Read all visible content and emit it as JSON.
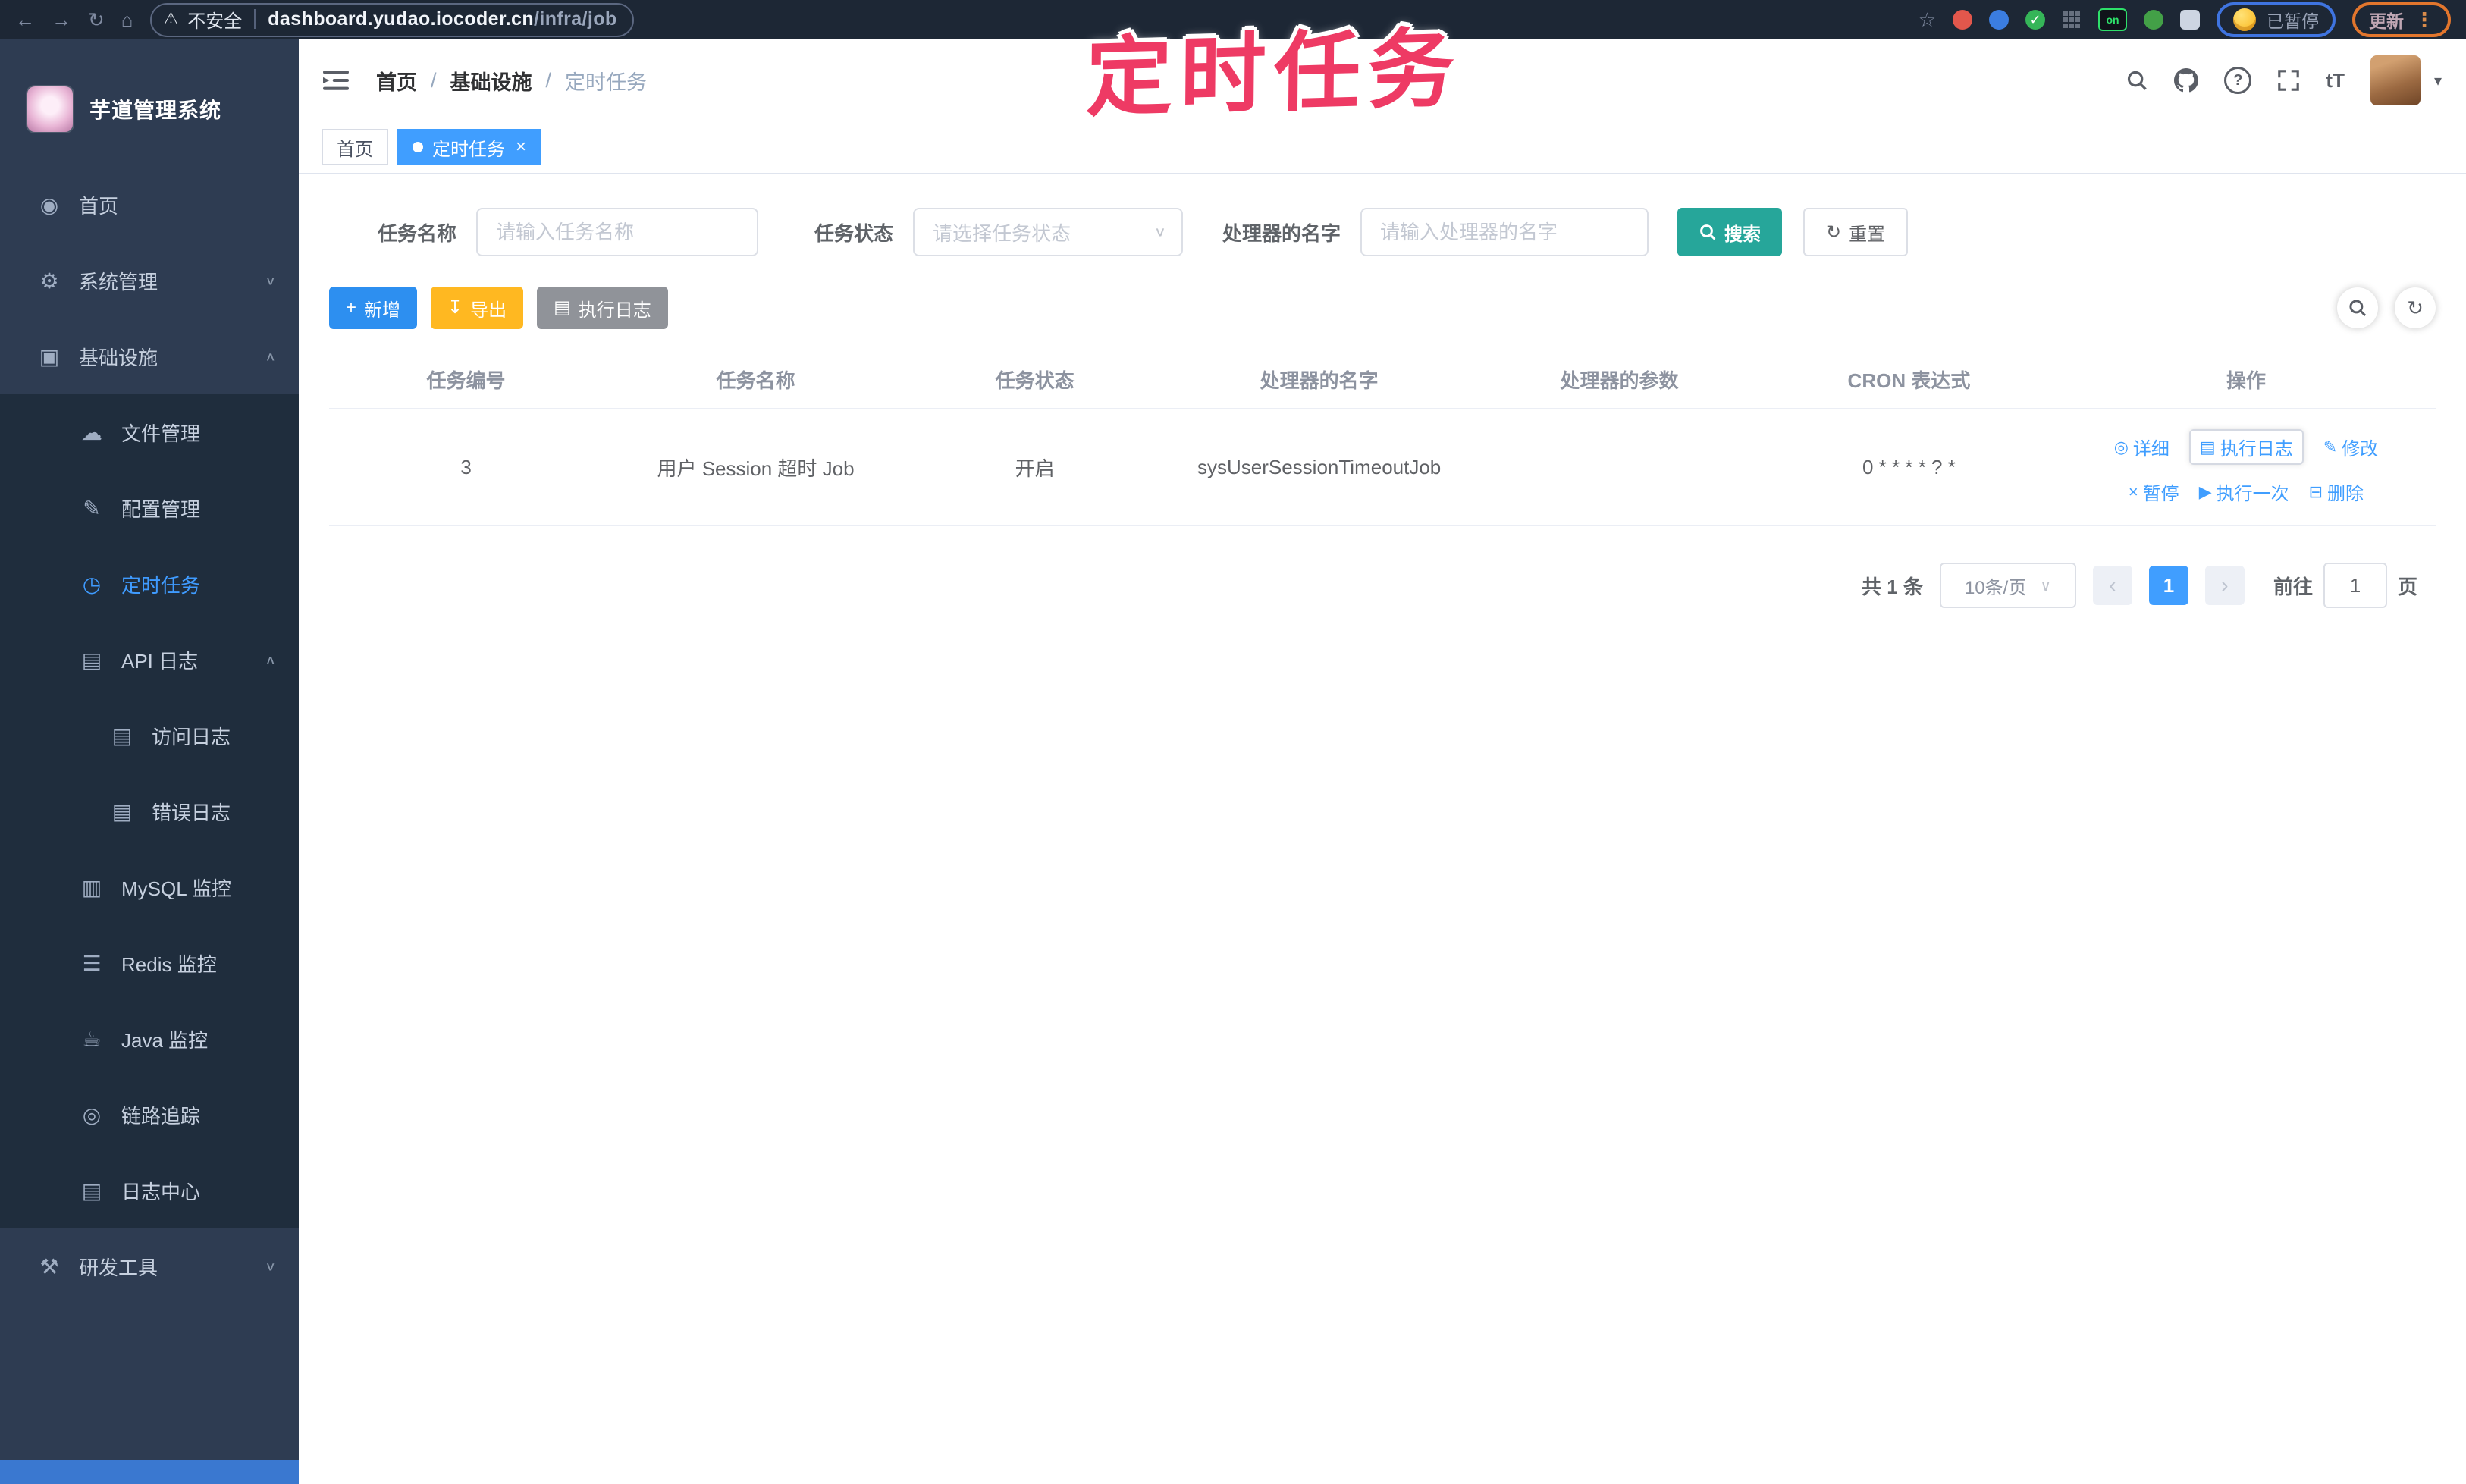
{
  "browser": {
    "security_warning": "不安全",
    "url_domain": "dashboard.yudao.iocoder.cn",
    "url_path": "/infra/job",
    "ext_on_badge": "on",
    "paused_badge": "已暂停",
    "update_button": "更新"
  },
  "overlay_annotation": "定时任务",
  "sidebar": {
    "logo_title": "芋道管理系统",
    "items": [
      {
        "label": "首页"
      },
      {
        "label": "系统管理"
      },
      {
        "label": "基础设施"
      },
      {
        "label": "文件管理"
      },
      {
        "label": "配置管理"
      },
      {
        "label": "定时任务"
      },
      {
        "label": "API 日志"
      },
      {
        "label": "访问日志"
      },
      {
        "label": "错误日志"
      },
      {
        "label": "MySQL 监控"
      },
      {
        "label": "Redis 监控"
      },
      {
        "label": "Java 监控"
      },
      {
        "label": "链路追踪"
      },
      {
        "label": "日志中心"
      },
      {
        "label": "研发工具"
      }
    ]
  },
  "breadcrumb": {
    "items": [
      "首页",
      "基础设施",
      "定时任务"
    ],
    "separator": "/"
  },
  "tags": {
    "home": "首页",
    "active": "定时任务"
  },
  "filters": {
    "name_label": "任务名称",
    "name_placeholder": "请输入任务名称",
    "status_label": "任务状态",
    "status_placeholder": "请选择任务状态",
    "handler_label": "处理器的名字",
    "handler_placeholder": "请输入处理器的名字",
    "search_label": "搜索",
    "reset_label": "重置"
  },
  "toolbar": {
    "add_label": "新增",
    "export_label": "导出",
    "exec_log_label": "执行日志"
  },
  "table": {
    "columns": [
      "任务编号",
      "任务名称",
      "任务状态",
      "处理器的名字",
      "处理器的参数",
      "CRON 表达式",
      "操作"
    ],
    "row": {
      "id": "3",
      "name": "用户 Session 超时 Job",
      "status": "开启",
      "handler": "sysUserSessionTimeoutJob",
      "params": "",
      "cron": "0 * * * * ? *"
    },
    "actions": {
      "detail": "详细",
      "log": "执行日志",
      "edit": "修改",
      "pause": "暂停",
      "run_once": "执行一次",
      "delete": "删除"
    }
  },
  "pagination": {
    "total": "共 1 条",
    "page_size": "10条/页",
    "page": "1",
    "goto_label": "前往",
    "goto_value": "1",
    "unit_label": "页"
  },
  "icons": {
    "back": "←",
    "forward": "→",
    "reload": "↻",
    "home": "⌂",
    "warning": "⚠",
    "star": "☆",
    "kebab": "⋮",
    "check": "✓",
    "caret_down": "▾",
    "close": "×",
    "chevron_down": "∨",
    "chevron_up": "∧",
    "question": "?",
    "font_size": "tT",
    "menu_dashboard": "◉",
    "menu_system": "⚙",
    "menu_infra": "▣",
    "menu_file": "☁",
    "menu_config": "✎",
    "menu_job": "◷",
    "menu_api_log": "▤",
    "menu_access_log": "▤",
    "menu_error_log": "▤",
    "menu_mysql": "▥",
    "menu_redis": "☰",
    "menu_java": "☕",
    "menu_trace": "◎",
    "menu_log_center": "▤",
    "menu_devtools": "⚒",
    "plus": "+",
    "download": "↧",
    "doc": "▤",
    "refresh": "↻",
    "op_detail": "◎",
    "op_log": "▤",
    "op_edit": "✎",
    "op_pause": "×",
    "op_run": "▶",
    "op_delete": "⊟",
    "select_caret": "∨",
    "prev": "‹",
    "next": "›"
  },
  "colors": {
    "accent_blue": "#409eff",
    "button_blue": "#2d8ff0",
    "search_teal": "#26a69a",
    "export_yellow": "#ffb821",
    "log_gray": "#909399",
    "annotation_red": "#ee3a64",
    "sidebar_bg": "#2e3c52",
    "submenu_bg": "#1f2d3d",
    "browser_bar_bg": "#1d2735"
  }
}
